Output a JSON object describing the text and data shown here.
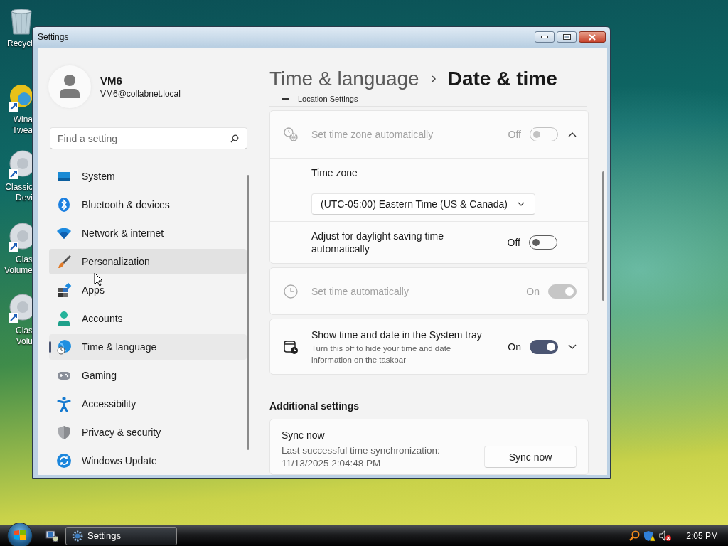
{
  "desktop_icons": [
    {
      "kind": "recycle",
      "lines": [
        "Recycl"
      ]
    },
    {
      "kind": "app",
      "lines": [
        "Wina",
        "Twea"
      ]
    },
    {
      "kind": "speaker",
      "lines": [
        "Classic",
        "Devi"
      ]
    },
    {
      "kind": "speaker",
      "lines": [
        "Clas",
        "Volume"
      ]
    },
    {
      "kind": "speaker",
      "lines": [
        "Clas",
        "Volu"
      ]
    }
  ],
  "window": {
    "title": "Settings"
  },
  "account": {
    "name": "VM6",
    "email": "VM6@collabnet.local"
  },
  "search": {
    "placeholder": "Find a setting"
  },
  "nav": [
    {
      "kind": "system",
      "label": "System",
      "selected": false,
      "hovered": false
    },
    {
      "kind": "bluetooth",
      "label": "Bluetooth & devices",
      "selected": false,
      "hovered": false
    },
    {
      "kind": "network",
      "label": "Network & internet",
      "selected": false,
      "hovered": false
    },
    {
      "kind": "personalization",
      "label": "Personalization",
      "selected": false,
      "hovered": true
    },
    {
      "kind": "apps",
      "label": "Apps",
      "selected": false,
      "hovered": false
    },
    {
      "kind": "accounts",
      "label": "Accounts",
      "selected": false,
      "hovered": false
    },
    {
      "kind": "time",
      "label": "Time & language",
      "selected": true,
      "hovered": false
    },
    {
      "kind": "gaming",
      "label": "Gaming",
      "selected": false,
      "hovered": false
    },
    {
      "kind": "accessibility",
      "label": "Accessibility",
      "selected": false,
      "hovered": false
    },
    {
      "kind": "privacy",
      "label": "Privacy & security",
      "selected": false,
      "hovered": false
    },
    {
      "kind": "update",
      "label": "Windows Update",
      "selected": false,
      "hovered": false
    }
  ],
  "breadcrumb": {
    "parent": "Time & language",
    "current": "Date & time"
  },
  "partial_section": {
    "label": "Location Settings"
  },
  "cards": [
    {
      "rows": [
        {
          "kind": "toggle",
          "label": "Set time zone automatically",
          "disabled": true,
          "state_text": "Off",
          "on": false,
          "expanded": true
        },
        {
          "kind": "dropdown",
          "label": "Time zone",
          "value": "(UTC-05:00) Eastern Time (US & Canada)"
        },
        {
          "kind": "toggle",
          "label": "Adjust for daylight saving time automatically",
          "disabled": false,
          "state_text": "Off",
          "on": false
        }
      ]
    },
    {
      "rows": [
        {
          "kind": "toggle",
          "label": "Set time automatically",
          "disabled": true,
          "state_text": "On",
          "on": true
        }
      ]
    },
    {
      "rows": [
        {
          "kind": "toggle",
          "label": "Show time and date in the System tray",
          "description": "Turn this off to hide your time and date information on the taskbar",
          "disabled": false,
          "state_text": "On",
          "on": true,
          "expanded": false
        }
      ]
    }
  ],
  "additional": {
    "heading": "Additional settings",
    "sync": {
      "title": "Sync now",
      "description": "Last successful time synchronization: 11/13/2025 2:04:48 PM",
      "button": "Sync now"
    }
  },
  "taskbar": {
    "tasks": [
      {
        "label": "Settings",
        "selected": true
      }
    ],
    "clock": "2:05 PM"
  }
}
